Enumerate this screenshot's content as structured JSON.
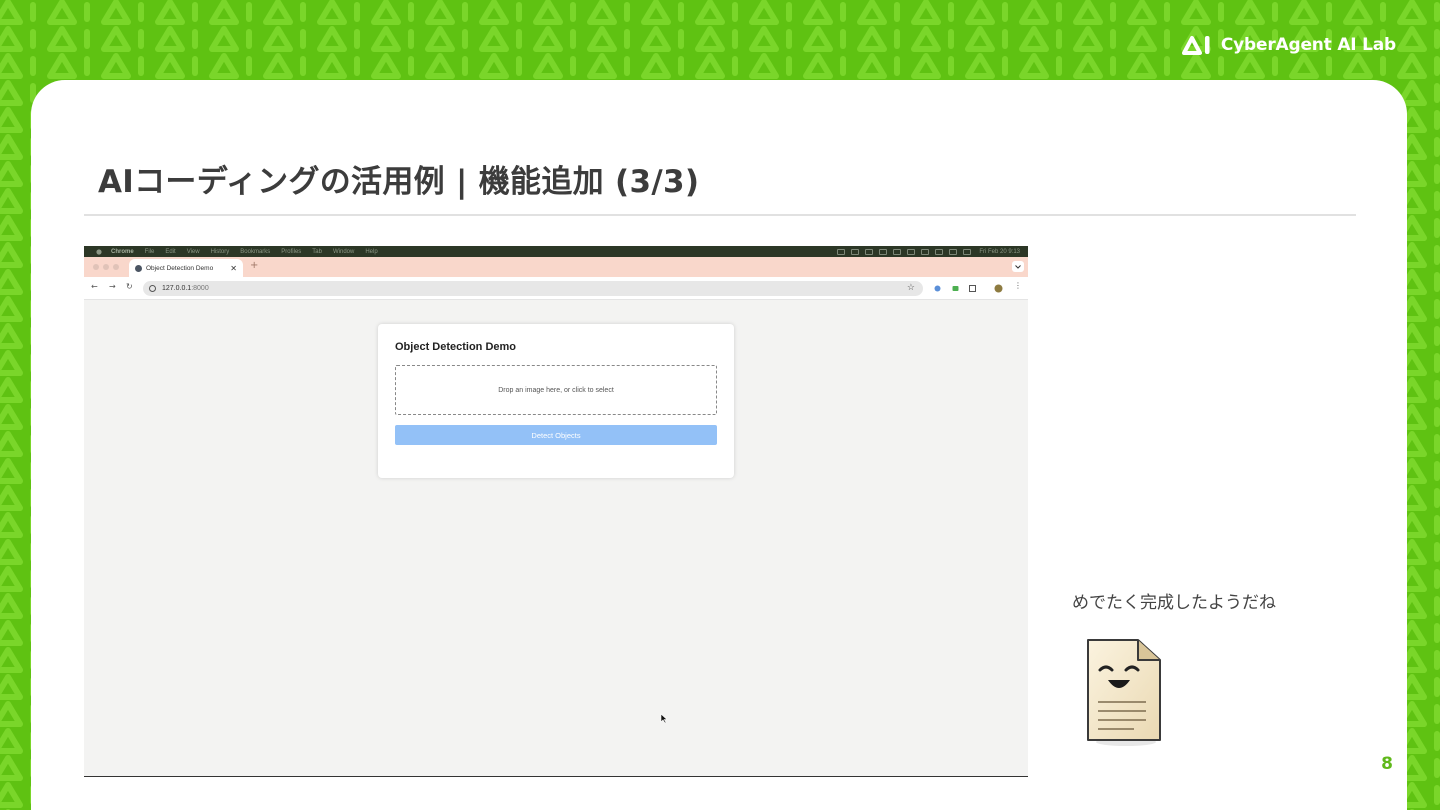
{
  "brand": {
    "name": "CyberAgent AI Lab"
  },
  "slide": {
    "title": "AIコーディングの活用例 | 機能追加 (3/3)",
    "caption": "めでたく完成したようだね",
    "page_number": "8"
  },
  "colors": {
    "brand_green": "#5fc212",
    "button_blue": "#93c1f7",
    "tab_strip": "#f9d7cb"
  },
  "screenshot": {
    "menubar": {
      "items": [
        "Chrome",
        "File",
        "Edit",
        "View",
        "History",
        "Bookmarks",
        "Profiles",
        "Tab",
        "Window",
        "Help"
      ],
      "clock": "Fri Feb 20  9:13"
    },
    "tab": {
      "title": "Object Detection Demo",
      "close": "✕",
      "new_tab": "+"
    },
    "toolbar": {
      "url_host": "127.0.0.1",
      "url_port": ":8000"
    },
    "app": {
      "title": "Object Detection Demo",
      "dropzone_text": "Drop an image here, or click to select",
      "detect_button": "Detect Objects"
    }
  }
}
